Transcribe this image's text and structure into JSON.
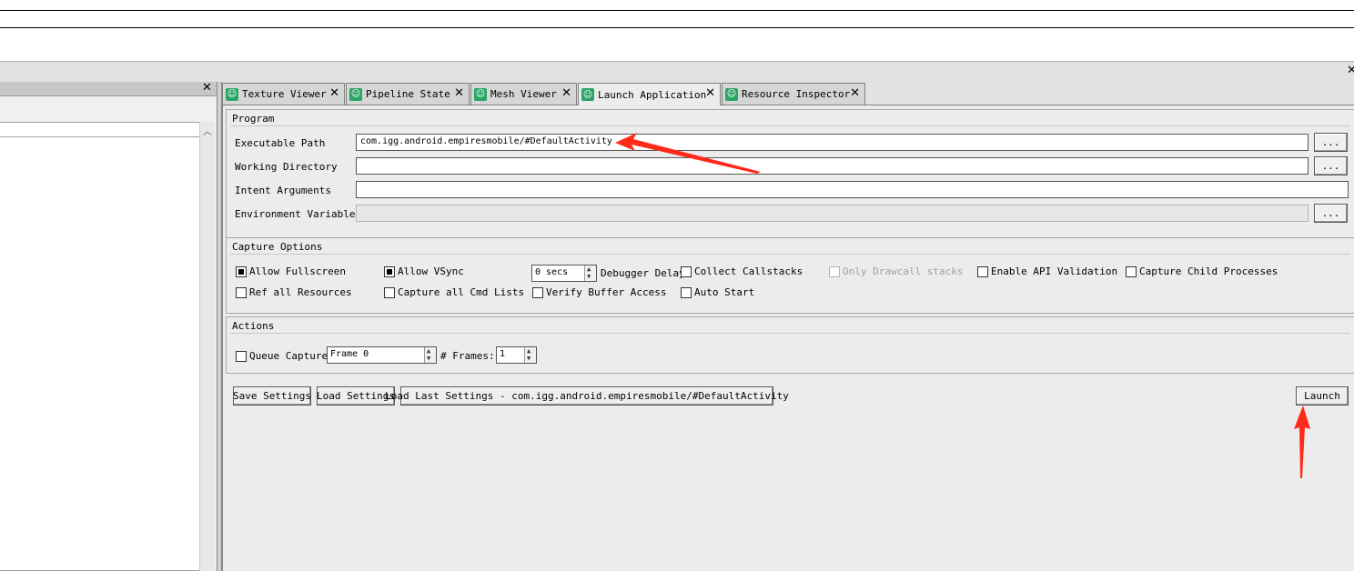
{
  "tabs": [
    {
      "label": "Texture Viewer",
      "active": false
    },
    {
      "label": "Pipeline State",
      "active": false
    },
    {
      "label": "Mesh Viewer",
      "active": false
    },
    {
      "label": "Launch Application",
      "active": true
    },
    {
      "label": "Resource Inspector",
      "active": false
    }
  ],
  "icons": {
    "tab": "viewer-icon",
    "close": "close-icon",
    "spin_up": "arrow-up-icon",
    "spin_down": "arrow-down-icon",
    "scroll_up": "chevron-up-icon"
  },
  "glyphs": {
    "close": "✕",
    "browse": "...",
    "tab_icon": "☺",
    "up": "▲",
    "down": "▼",
    "scroll_up": "︿"
  },
  "program": {
    "title": "Program",
    "executable_label": "Executable Path",
    "executable_value": "com.igg.android.empiresmobile/#DefaultActivity",
    "working_dir_label": "Working Directory",
    "working_dir_value": "",
    "intent_label": "Intent Arguments",
    "intent_value": "",
    "env_label": "Environment Variables",
    "env_value": ""
  },
  "capture_options": {
    "title": "Capture Options",
    "allow_fullscreen": {
      "label": "Allow Fullscreen",
      "checked": true
    },
    "allow_vsync": {
      "label": "Allow VSync",
      "checked": true
    },
    "debugger_delay_value": "0 secs",
    "debugger_delay_label": "Debugger Delay",
    "collect_callstacks": {
      "label": "Collect Callstacks",
      "checked": false
    },
    "only_drawcall": {
      "label": "Only Drawcall stacks",
      "checked": false,
      "disabled": true
    },
    "enable_api_validation": {
      "label": "Enable API Validation",
      "checked": false
    },
    "capture_child": {
      "label": "Capture Child Processes",
      "checked": false
    },
    "ref_all_resources": {
      "label": "Ref all Resources",
      "checked": false
    },
    "capture_all_cmd": {
      "label": "Capture all Cmd Lists",
      "checked": false
    },
    "verify_buffer": {
      "label": "Verify Buffer Access",
      "checked": false
    },
    "auto_start": {
      "label": "Auto Start",
      "checked": false
    }
  },
  "actions": {
    "title": "Actions",
    "queue_capture": {
      "label": "Queue Capture",
      "checked": false
    },
    "frame_value": "Frame 0",
    "frames_label": "# Frames:",
    "frames_value": "1"
  },
  "buttons": {
    "save": "Save Settings",
    "load": "Load Settings",
    "load_last": "Load Last Settings - com.igg.android.empiresmobile/#DefaultActivity",
    "launch": "Launch"
  },
  "annotation_color": "#ff2a1a",
  "accent_tab_icon": "#2aa565"
}
